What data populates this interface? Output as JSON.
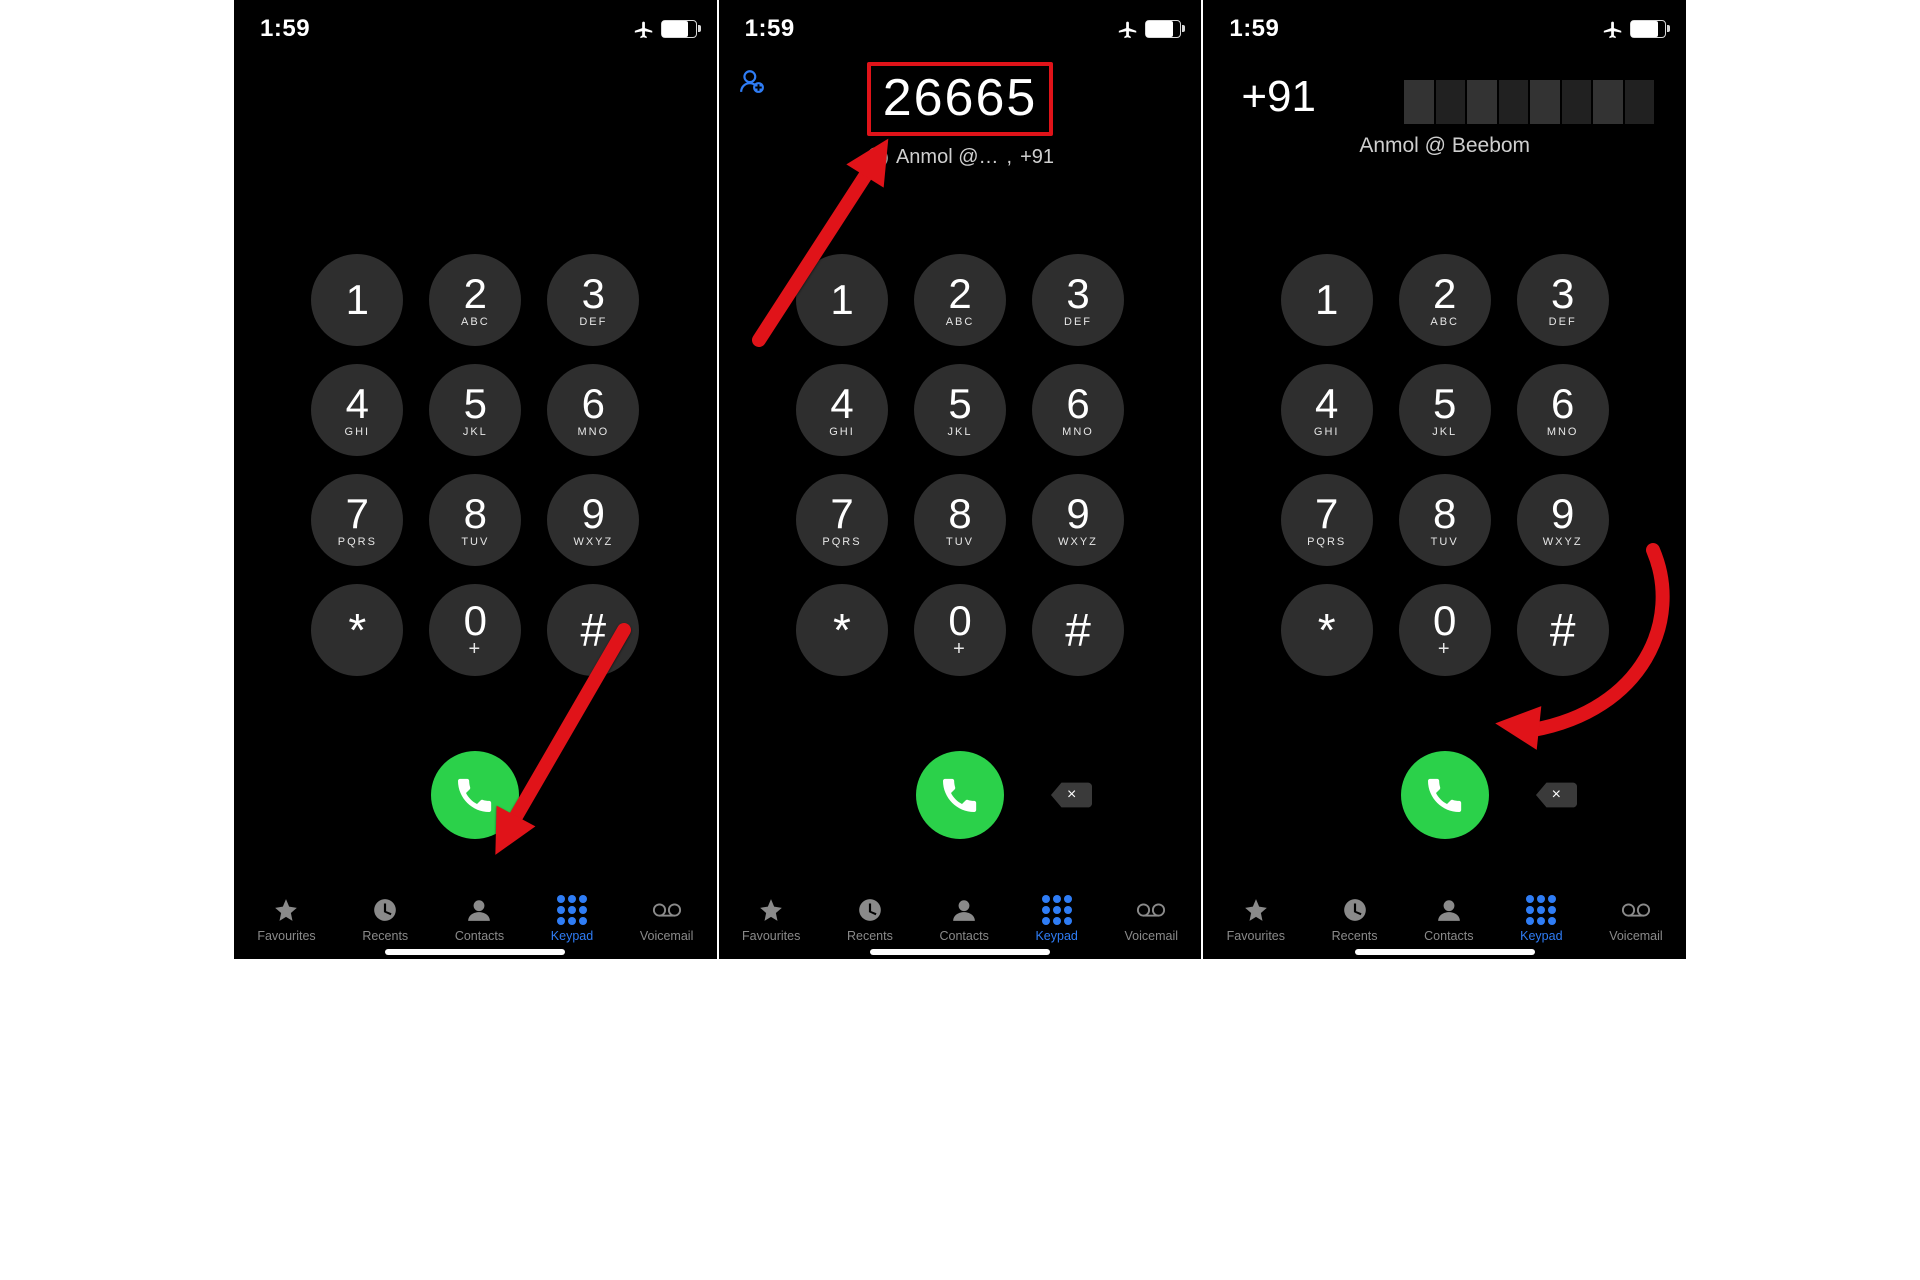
{
  "status": {
    "time": "1:59"
  },
  "panes": {
    "p1": {
      "arrow_target": "keypad-tab"
    },
    "p2": {
      "dialed": "26665",
      "suggestion_name": "Anmol @…",
      "suggestion_sep": ",",
      "suggestion_prefix": "+91",
      "arrow_target": "contact-suggestion"
    },
    "p3": {
      "prefix": "+91",
      "caller_name": "Anmol @ Beebom",
      "arrow_target": "call-button"
    }
  },
  "keypad": {
    "keys": [
      {
        "digit": "1",
        "letters": ""
      },
      {
        "digit": "2",
        "letters": "ABC"
      },
      {
        "digit": "3",
        "letters": "DEF"
      },
      {
        "digit": "4",
        "letters": "GHI"
      },
      {
        "digit": "5",
        "letters": "JKL"
      },
      {
        "digit": "6",
        "letters": "MNO"
      },
      {
        "digit": "7",
        "letters": "PQRS"
      },
      {
        "digit": "8",
        "letters": "TUV"
      },
      {
        "digit": "9",
        "letters": "WXYZ"
      },
      {
        "digit": "*",
        "letters": "",
        "sym": true
      },
      {
        "digit": "0",
        "letters": "+",
        "zero": true
      },
      {
        "digit": "#",
        "letters": "",
        "sym": true
      }
    ]
  },
  "tabs": {
    "items": [
      {
        "id": "favourites",
        "label": "Favourites",
        "icon": "star"
      },
      {
        "id": "recents",
        "label": "Recents",
        "icon": "clock"
      },
      {
        "id": "contacts",
        "label": "Contacts",
        "icon": "person"
      },
      {
        "id": "keypad",
        "label": "Keypad",
        "icon": "keypad",
        "active": true
      },
      {
        "id": "voicemail",
        "label": "Voicemail",
        "icon": "voicemail"
      }
    ]
  },
  "icons": {
    "delete_symbol": "×"
  },
  "colors": {
    "accent": "#2f7df6",
    "call": "#2bd14a",
    "annotate": "#e01319"
  }
}
